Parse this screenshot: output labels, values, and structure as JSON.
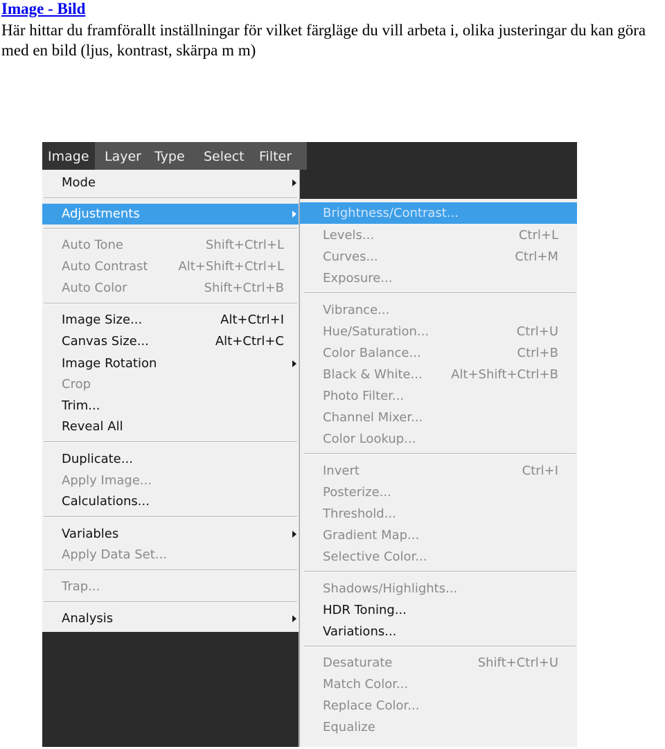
{
  "doc": {
    "title": "Image  - Bild",
    "description": "Här hittar du framförallt inställningar för vilket färgläge du vill arbeta i, olika justeringar du kan göra med en bild (ljus, kontrast, skärpa m m)"
  },
  "menubar": {
    "items": [
      {
        "label": "Image"
      },
      {
        "label": "Layer"
      },
      {
        "label": "Type"
      },
      {
        "label": "Select"
      },
      {
        "label": "Filter"
      }
    ]
  },
  "image_menu": {
    "items": [
      {
        "label": "Mode",
        "shortcut": "",
        "submenu": true
      },
      {
        "label": "Adjustments",
        "shortcut": "",
        "submenu": true
      },
      {
        "label": "Auto Tone",
        "shortcut": "Shift+Ctrl+L"
      },
      {
        "label": "Auto Contrast",
        "shortcut": "Alt+Shift+Ctrl+L"
      },
      {
        "label": "Auto Color",
        "shortcut": "Shift+Ctrl+B"
      },
      {
        "label": "Image Size...",
        "shortcut": "Alt+Ctrl+I"
      },
      {
        "label": "Canvas Size...",
        "shortcut": "Alt+Ctrl+C"
      },
      {
        "label": "Image Rotation",
        "shortcut": "",
        "submenu": true
      },
      {
        "label": "Crop",
        "shortcut": ""
      },
      {
        "label": "Trim...",
        "shortcut": ""
      },
      {
        "label": "Reveal All",
        "shortcut": ""
      },
      {
        "label": "Duplicate...",
        "shortcut": ""
      },
      {
        "label": "Apply Image...",
        "shortcut": ""
      },
      {
        "label": "Calculations...",
        "shortcut": ""
      },
      {
        "label": "Variables",
        "shortcut": "",
        "submenu": true
      },
      {
        "label": "Apply Data Set...",
        "shortcut": ""
      },
      {
        "label": "Trap...",
        "shortcut": ""
      },
      {
        "label": "Analysis",
        "shortcut": "",
        "submenu": true
      }
    ]
  },
  "adjustments_menu": {
    "items": [
      {
        "label": "Brightness/Contrast...",
        "shortcut": ""
      },
      {
        "label": "Levels...",
        "shortcut": "Ctrl+L"
      },
      {
        "label": "Curves...",
        "shortcut": "Ctrl+M"
      },
      {
        "label": "Exposure...",
        "shortcut": ""
      },
      {
        "label": "Vibrance...",
        "shortcut": ""
      },
      {
        "label": "Hue/Saturation...",
        "shortcut": "Ctrl+U"
      },
      {
        "label": "Color Balance...",
        "shortcut": "Ctrl+B"
      },
      {
        "label": "Black & White...",
        "shortcut": "Alt+Shift+Ctrl+B"
      },
      {
        "label": "Photo Filter...",
        "shortcut": ""
      },
      {
        "label": "Channel Mixer...",
        "shortcut": ""
      },
      {
        "label": "Color Lookup...",
        "shortcut": ""
      },
      {
        "label": "Invert",
        "shortcut": "Ctrl+I"
      },
      {
        "label": "Posterize...",
        "shortcut": ""
      },
      {
        "label": "Threshold...",
        "shortcut": ""
      },
      {
        "label": "Gradient Map...",
        "shortcut": ""
      },
      {
        "label": "Selective Color...",
        "shortcut": ""
      },
      {
        "label": "Shadows/Highlights...",
        "shortcut": ""
      },
      {
        "label": "HDR Toning...",
        "shortcut": ""
      },
      {
        "label": "Variations...",
        "shortcut": ""
      },
      {
        "label": "Desaturate",
        "shortcut": "Shift+Ctrl+U"
      },
      {
        "label": "Match Color...",
        "shortcut": ""
      },
      {
        "label": "Replace Color...",
        "shortcut": ""
      },
      {
        "label": "Equalize",
        "shortcut": ""
      }
    ]
  },
  "colors": {
    "highlight": "#3d9ee8",
    "menubar": "#535353",
    "menu_bg": "#f0f0f0",
    "workspace": "#2b2b2b",
    "disabled_text": "#8a8a8a",
    "link": "#0000ee"
  }
}
